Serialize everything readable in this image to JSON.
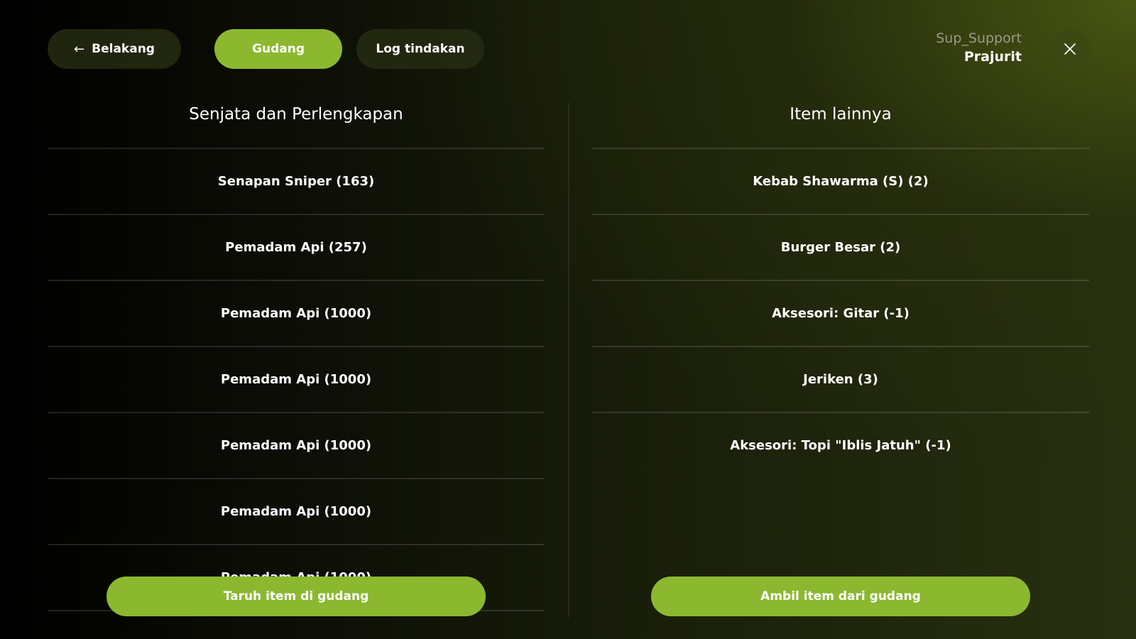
{
  "header": {
    "back_label": "Belakang",
    "back_icon": "arrow-left-icon",
    "tabs": [
      {
        "label": "Gudang",
        "active": true
      },
      {
        "label": "Log tindakan",
        "active": false
      }
    ],
    "user": {
      "name": "Sup_Support",
      "role": "Prajurit"
    },
    "close_icon": "close-icon"
  },
  "left_column": {
    "title": "Senjata dan Perlengkapan",
    "items": [
      "Senapan Sniper (163)",
      "Pemadam Api (257)",
      "Pemadam Api (1000)",
      "Pemadam Api (1000)",
      "Pemadam Api (1000)",
      "Pemadam Api (1000)",
      "Pemadam Api (1000)"
    ],
    "action_label": "Taruh item di gudang"
  },
  "right_column": {
    "title": "Item lainnya",
    "items": [
      "Kebab Shawarma (S) (2)",
      "Burger Besar (2)",
      "Aksesori: Gitar (-1)",
      "Jeriken (3)",
      "Aksesori: Topi \"Iblis Jatuh\" (-1)"
    ],
    "action_label": "Ambil item dari gudang"
  },
  "colors": {
    "accent": "#8cb830",
    "pill_dark": "#262c12",
    "muted_text": "#9a9c8a"
  }
}
